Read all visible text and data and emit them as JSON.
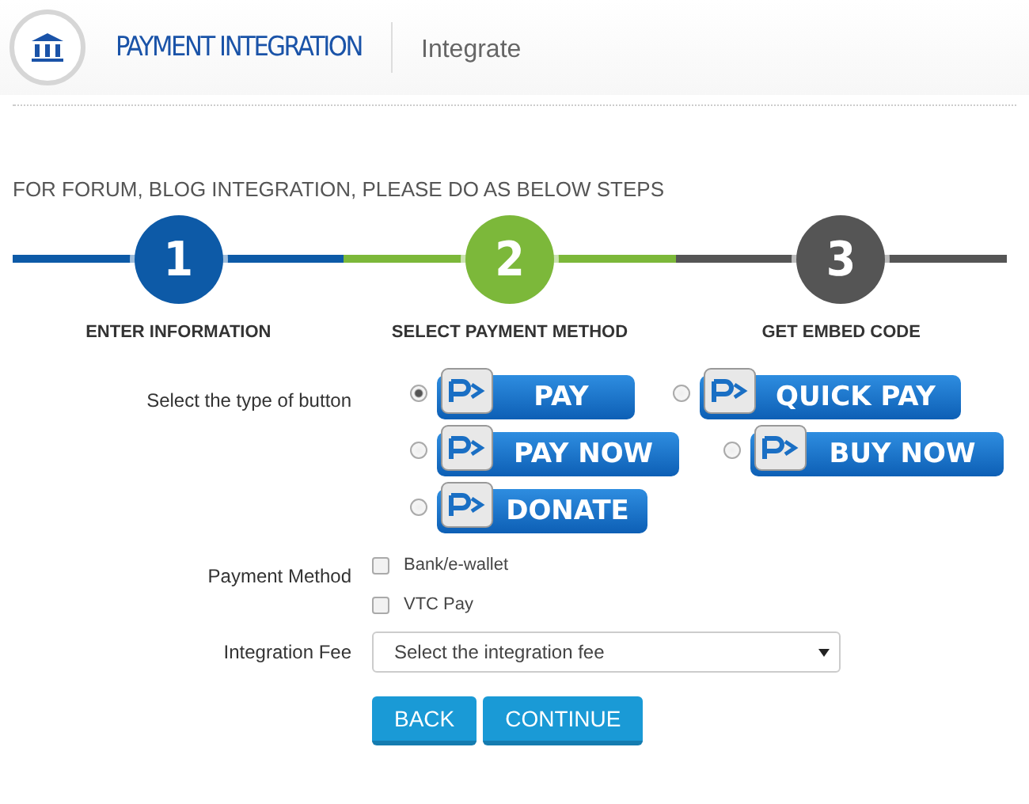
{
  "header": {
    "title": "PAYMENT INTEGRATION",
    "subtitle": "Integrate"
  },
  "instruction": "FOR FORUM, BLOG INTEGRATION, PLEASE DO AS BELOW STEPS",
  "steps": [
    {
      "number": "1",
      "label": "ENTER INFORMATION",
      "color": "#0d5aa7"
    },
    {
      "number": "2",
      "label": "SELECT PAYMENT METHOD",
      "color": "#7cb83a"
    },
    {
      "number": "3",
      "label": "GET EMBED CODE",
      "color": "#555555"
    }
  ],
  "button_type": {
    "label": "Select the type of button",
    "options": [
      [
        {
          "text": "PAY",
          "selected": true
        },
        {
          "text": "QUICK PAY",
          "selected": false
        }
      ],
      [
        {
          "text": "PAY NOW",
          "selected": false
        },
        {
          "text": "BUY NOW",
          "selected": false
        }
      ],
      [
        {
          "text": "DONATE",
          "selected": false
        }
      ]
    ]
  },
  "payment_method": {
    "label": "Payment Method",
    "options": [
      {
        "text": "Bank/e-wallet",
        "checked": false
      },
      {
        "text": "VTC Pay",
        "checked": false
      }
    ]
  },
  "integration_fee": {
    "label": "Integration Fee",
    "placeholder": "Select the integration fee"
  },
  "buttons": [
    "BACK",
    "CONTINUE"
  ]
}
